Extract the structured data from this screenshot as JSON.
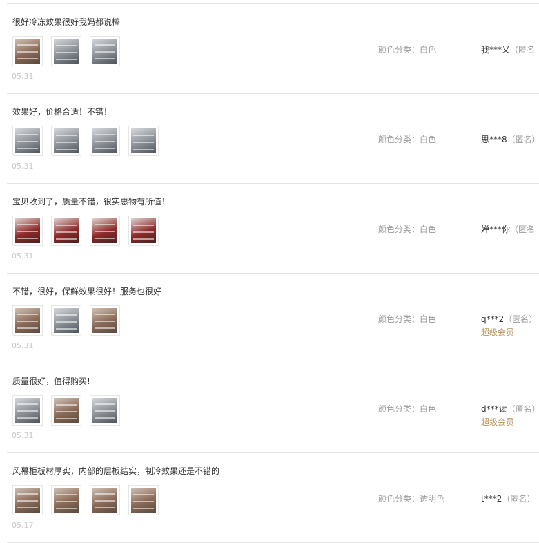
{
  "reviews": [
    {
      "content": "很好冷冻效果很好我妈都说棒",
      "sku": "颜色分类：白色",
      "user": "我***乂",
      "anon": "（匿名",
      "vip": "",
      "date": "05.31",
      "photos": [
        "warm",
        "steel",
        "steel"
      ]
    },
    {
      "content": "效果好，价格合适！不错！",
      "sku": "颜色分类：白色",
      "user": "思***8",
      "anon": "（匿名）",
      "vip": "",
      "date": "05.31",
      "photos": [
        "steel",
        "steel",
        "steel",
        "steel"
      ]
    },
    {
      "content": "宝贝收到了，质量不错，很实惠物有所值！",
      "sku": "颜色分类：白色",
      "user": "婵***你",
      "anon": "（匿名",
      "vip": "",
      "date": "05.31",
      "photos": [
        "red",
        "red",
        "red",
        "red"
      ]
    },
    {
      "content": "不错，很好，保鲜效果很好！服务也很好",
      "sku": "颜色分类：白色",
      "user": "q***2",
      "anon": "（匿名）",
      "vip": "超级会员",
      "date": "05.31",
      "photos": [
        "warm",
        "steel",
        "warm"
      ]
    },
    {
      "content": "质量很好，值得购买!",
      "sku": "颜色分类：白色",
      "user": "d***读",
      "anon": "（匿名）",
      "vip": "超级会员",
      "date": "05.31",
      "photos": [
        "steel",
        "warm",
        "steel"
      ]
    },
    {
      "content": "风幕柜板材厚实，内部的层板结实，制冷效果还是不错的",
      "sku": "颜色分类：透明色",
      "user": "t***2",
      "anon": "（匿名）",
      "vip": "",
      "date": "05.17",
      "photos": [
        "warm",
        "warm",
        "warm",
        "warm"
      ]
    }
  ],
  "colors": {
    "warm": [
      "#8b6a57",
      "#cfc2b6",
      "#5a4a40"
    ],
    "steel": [
      "#8a8f95",
      "#d5d8dc",
      "#4f555c"
    ],
    "red": [
      "#8e2b2b",
      "#e0d3cf",
      "#4a2020"
    ],
    "vip": "#b9955a"
  }
}
